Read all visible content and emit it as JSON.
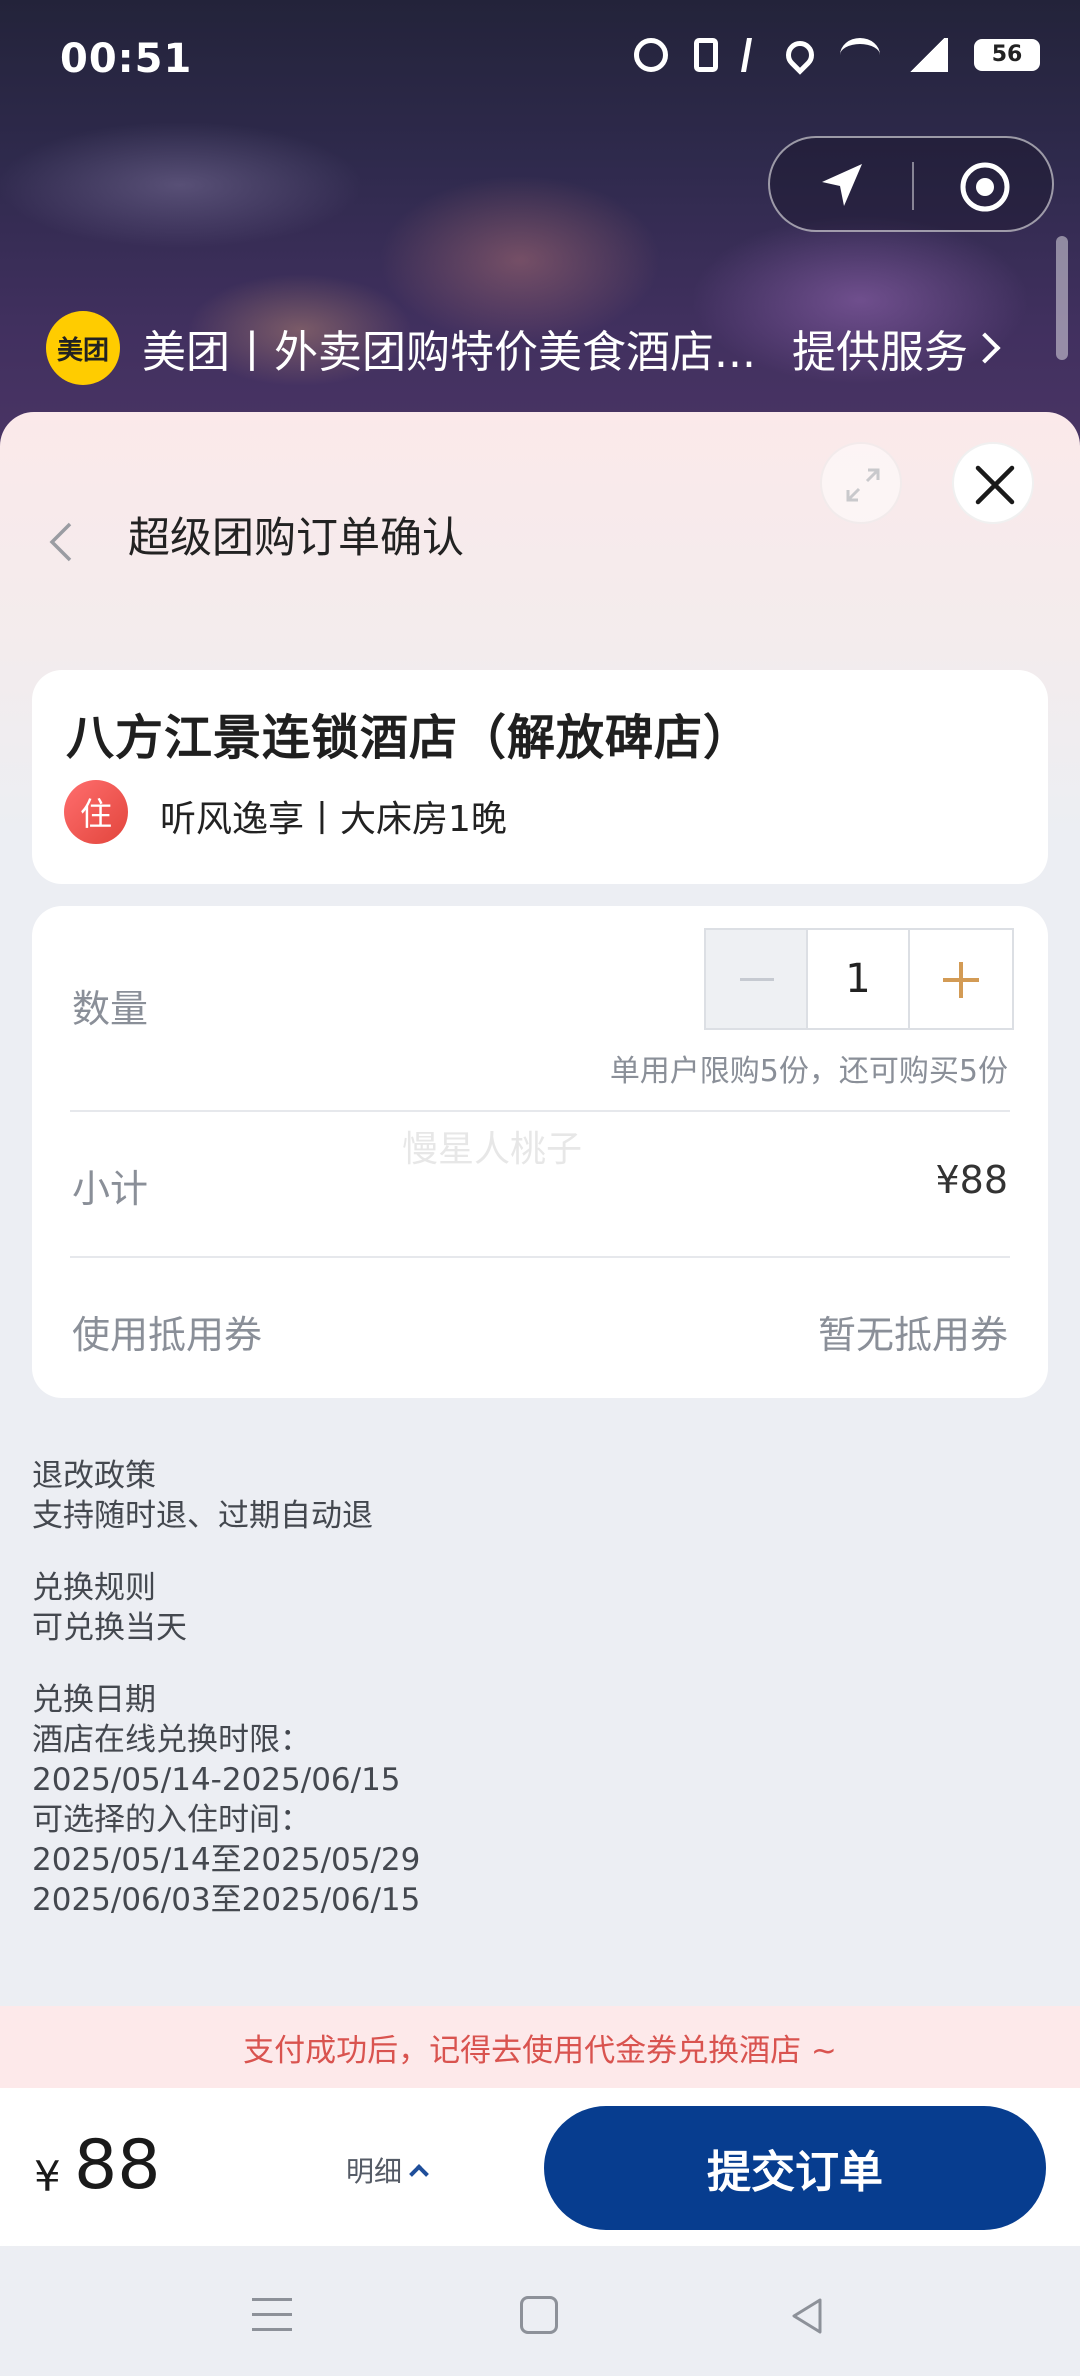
{
  "status_bar": {
    "time": "00:51",
    "battery": "56"
  },
  "mini_program": {
    "logo_text": "美团",
    "name": "美团丨外卖团购特价美食酒店...",
    "provide_label": "提供服务"
  },
  "page": {
    "title": "超级团购订单确认"
  },
  "hotel": {
    "name": "八方江景连锁酒店（解放碑店）",
    "badge": "住",
    "room": "听风逸享丨大床房1晚"
  },
  "order": {
    "quantity_label": "数量",
    "quantity_value": "1",
    "limit_text": "单用户限购5份，还可购买5份",
    "subtotal_label": "小计",
    "subtotal_value": "¥88",
    "coupon_label": "使用抵用券",
    "coupon_value": "暂无抵用券",
    "watermark": "慢星人桃子"
  },
  "policies": {
    "refund_title": "退改政策",
    "refund_text": "支持随时退、过期自动退",
    "redeem_title": "兑换规则",
    "redeem_text": "可兑换当天",
    "date_title": "兑换日期",
    "online_label": "酒店在线兑换时限：",
    "online_range": "2025/05/14-2025/06/15",
    "checkin_label": "可选择的入住时间：",
    "checkin_range_1": "2025/05/14至2025/05/29",
    "checkin_range_2": "2025/06/03至2025/06/15"
  },
  "notice": "支付成功后，记得去使用代金券兑换酒店 ~",
  "footer": {
    "currency": "¥",
    "total": "88",
    "detail_label": "明细",
    "submit_label": "提交订单"
  },
  "colors": {
    "primary": "#073d8f",
    "accent_plus": "#d39b55",
    "notice_text": "#d9534f",
    "brand_yellow": "#ffcc00"
  },
  "icons": [
    "navigation-arrow-icon",
    "target-icon",
    "expand-icon",
    "close-icon",
    "back-chevron-icon",
    "menu-icon",
    "home-icon",
    "back-triangle-icon"
  ]
}
